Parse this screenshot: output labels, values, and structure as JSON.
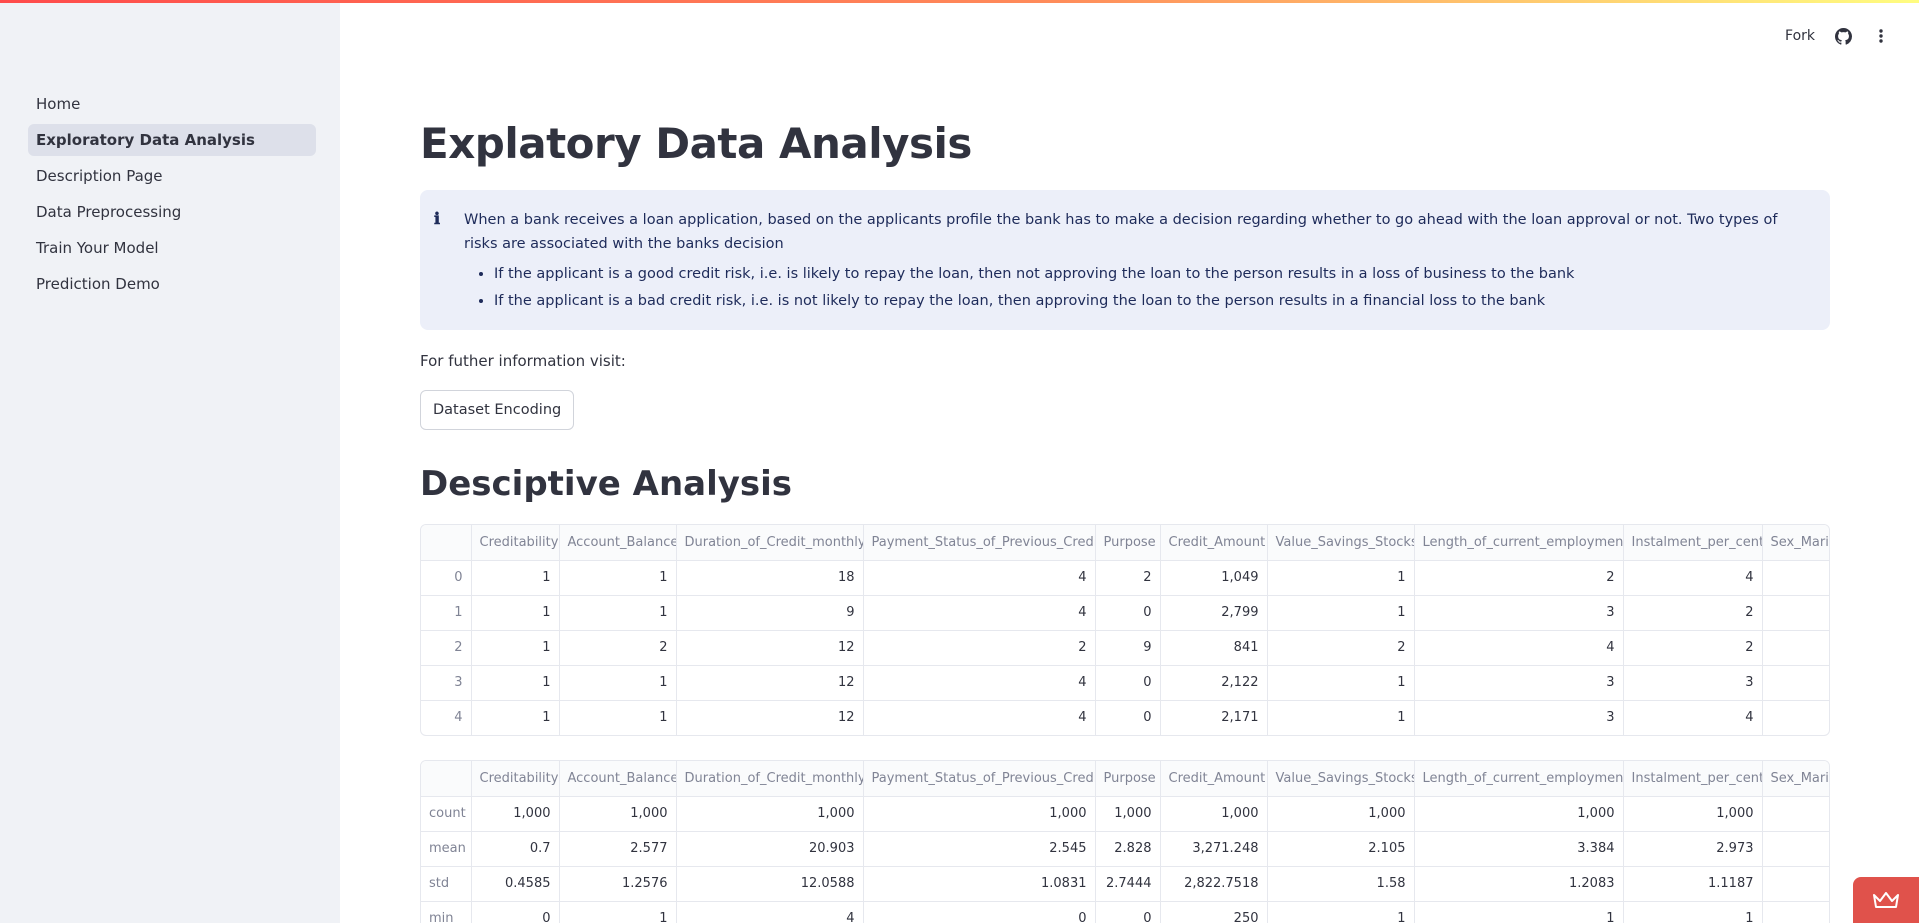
{
  "header": {
    "fork_label": "Fork",
    "github_icon": "github-icon",
    "menu_icon": "kebab-menu-icon"
  },
  "sidebar": {
    "items": [
      {
        "label": "Home",
        "active": false
      },
      {
        "label": "Exploratory Data Analysis",
        "active": true
      },
      {
        "label": "Description Page",
        "active": false
      },
      {
        "label": "Data Preprocessing",
        "active": false
      },
      {
        "label": "Train Your Model",
        "active": false
      },
      {
        "label": "Prediction Demo",
        "active": false
      }
    ]
  },
  "main": {
    "title": "Explatory Data Analysis",
    "info": {
      "text": "When a bank receives a loan application, based on the applicants profile the bank has to make a decision regarding whether to go ahead with the loan approval or not. Two types of risks are associated with the banks decision",
      "bullets": [
        "If the applicant is a good credit risk, i.e. is likely to repay the loan, then not approving the loan to the person results in a loss of business to the bank",
        "If the applicant is a bad credit risk, i.e. is not likely to repay the loan, then approving the loan to the person results in a financial loss to the bank"
      ]
    },
    "further_info": "For futher information visit:",
    "button_label": "Dataset Encoding",
    "section_title": "Desciptive Analysis"
  },
  "columns": [
    "Creditability",
    "Account_Balance",
    "Duration_of_Credit_monthly",
    "Payment_Status_of_Previous_Credit",
    "Purpose",
    "Credit_Amount",
    "Value_Savings_Stocks",
    "Length_of_current_employment",
    "Instalment_per_cent",
    "Sex_Marital_Status"
  ],
  "head_table": {
    "rows": [
      {
        "index": "0",
        "cells": [
          "1",
          "1",
          "18",
          "4",
          "2",
          "1,049",
          "1",
          "2",
          "4",
          ""
        ]
      },
      {
        "index": "1",
        "cells": [
          "1",
          "1",
          "9",
          "4",
          "0",
          "2,799",
          "1",
          "3",
          "2",
          ""
        ]
      },
      {
        "index": "2",
        "cells": [
          "1",
          "2",
          "12",
          "2",
          "9",
          "841",
          "2",
          "4",
          "2",
          ""
        ]
      },
      {
        "index": "3",
        "cells": [
          "1",
          "1",
          "12",
          "4",
          "0",
          "2,122",
          "1",
          "3",
          "3",
          ""
        ]
      },
      {
        "index": "4",
        "cells": [
          "1",
          "1",
          "12",
          "4",
          "0",
          "2,171",
          "1",
          "3",
          "4",
          ""
        ]
      }
    ]
  },
  "describe_table": {
    "rows": [
      {
        "index": "count",
        "cells": [
          "1,000",
          "1,000",
          "1,000",
          "1,000",
          "1,000",
          "1,000",
          "1,000",
          "1,000",
          "1,000",
          ""
        ]
      },
      {
        "index": "mean",
        "cells": [
          "0.7",
          "2.577",
          "20.903",
          "2.545",
          "2.828",
          "3,271.248",
          "2.105",
          "3.384",
          "2.973",
          ""
        ]
      },
      {
        "index": "std",
        "cells": [
          "0.4585",
          "1.2576",
          "12.0588",
          "1.0831",
          "2.7444",
          "2,822.7518",
          "1.58",
          "1.2083",
          "1.1187",
          ""
        ]
      },
      {
        "index": "min",
        "cells": [
          "0",
          "1",
          "4",
          "0",
          "0",
          "250",
          "1",
          "1",
          "1",
          ""
        ]
      }
    ]
  },
  "fab_icon": "crown-icon"
}
